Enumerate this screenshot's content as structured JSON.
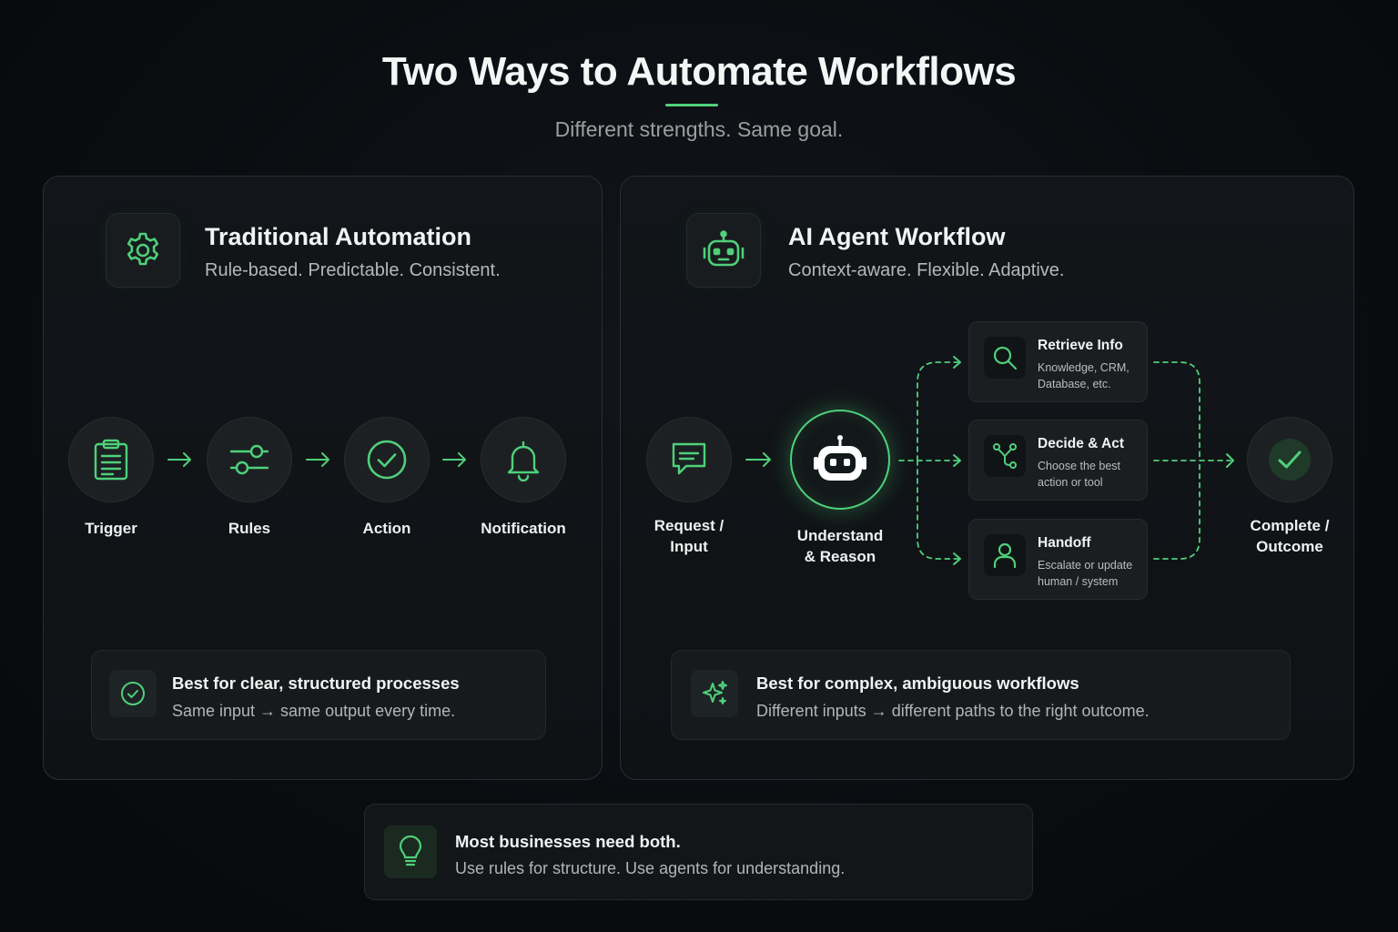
{
  "header": {
    "title": "Two Ways to Automate Workflows",
    "subtitle": "Different strengths. Same goal."
  },
  "colors": {
    "accent": "#4fd07a",
    "background": "#0b0d10",
    "panel": "#121519"
  },
  "traditional": {
    "icon": "gear-icon",
    "title": "Traditional Automation",
    "subtitle": "Rule-based. Predictable. Consistent.",
    "steps": [
      {
        "label": "Trigger",
        "icon": "clipboard-icon"
      },
      {
        "label": "Rules",
        "icon": "sliders-icon"
      },
      {
        "label": "Action",
        "icon": "check-circle-icon"
      },
      {
        "label": "Notification",
        "icon": "bell-icon"
      }
    ],
    "callout": {
      "icon": "check-circle-icon",
      "title": "Best for clear, structured processes",
      "text": "Same input → same output every time."
    }
  },
  "agent": {
    "icon": "robot-icon",
    "title": "AI Agent Workflow",
    "subtitle": "Context-aware. Flexible. Adaptive.",
    "input": {
      "label_line1": "Request /",
      "label_line2": "Input",
      "icon": "chat-icon"
    },
    "center": {
      "label_line1": "Understand",
      "label_line2": "& Reason",
      "icon": "robot-icon"
    },
    "options": [
      {
        "title": "Retrieve Info",
        "desc": "Knowledge, CRM, Database, etc.",
        "icon": "search-icon"
      },
      {
        "title": "Decide & Act",
        "desc": "Choose the best action or tool",
        "icon": "branch-icon"
      },
      {
        "title": "Handoff",
        "desc": "Escalate or update human / system",
        "icon": "person-icon"
      }
    ],
    "outcome": {
      "label_line1": "Complete /",
      "label_line2": "Outcome",
      "icon": "checkmark-icon"
    },
    "callout": {
      "icon": "sparkle-icon",
      "title": "Best for complex, ambiguous workflows",
      "text": "Different inputs → different paths to the right outcome."
    }
  },
  "summary": {
    "icon": "lightbulb-icon",
    "title": "Most businesses need both.",
    "text": "Use rules for structure. Use agents for understanding."
  }
}
